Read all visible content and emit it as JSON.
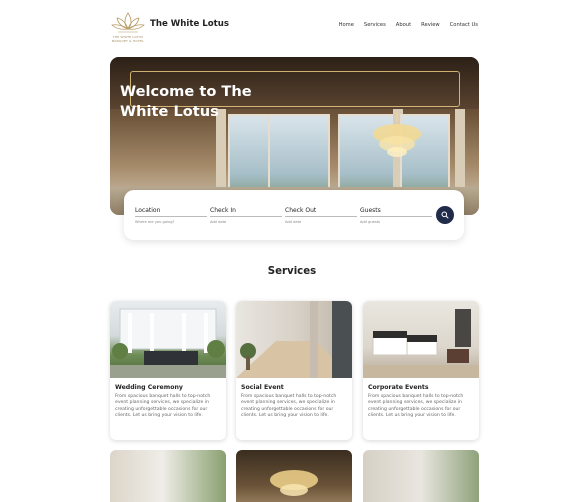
{
  "header": {
    "brand": "The White Lotus",
    "logo_caption_1": "THE WHITE LOTUS",
    "logo_caption_2": "BANQUET & HOTEL",
    "nav": [
      "Home",
      "Services",
      "About",
      "Review",
      "Contact Us"
    ]
  },
  "hero": {
    "title": "Welcome to The White Lotus"
  },
  "search": {
    "fields": [
      {
        "label": "Location",
        "placeholder": "Where are you going?"
      },
      {
        "label": "Check In",
        "placeholder": "Add date"
      },
      {
        "label": "Check Out",
        "placeholder": "Add date"
      },
      {
        "label": "Guests",
        "placeholder": "Add guests"
      }
    ],
    "button_icon": "search-icon"
  },
  "services": {
    "title": "Services",
    "cards": [
      {
        "title": "Wedding Ceremony",
        "text": "From spacious banquet halls to top-notch event planning services, we specialize in creating unforgettable occasions for our clients. Let us bring your vision to life."
      },
      {
        "title": "Social Event",
        "text": "From spacious banquet halls to top-notch event planning services, we specialize in creating unforgettable occasions for our clients. Let us bring your vision to life."
      },
      {
        "title": "Corporate Events",
        "text": "From spacious banquet halls to top-notch event planning services, we specialize in creating unforgettable occasions for our clients. Let us bring your vision to life."
      }
    ]
  },
  "colors": {
    "accent": "#202c4a",
    "text": "#222222",
    "muted": "#666666"
  }
}
